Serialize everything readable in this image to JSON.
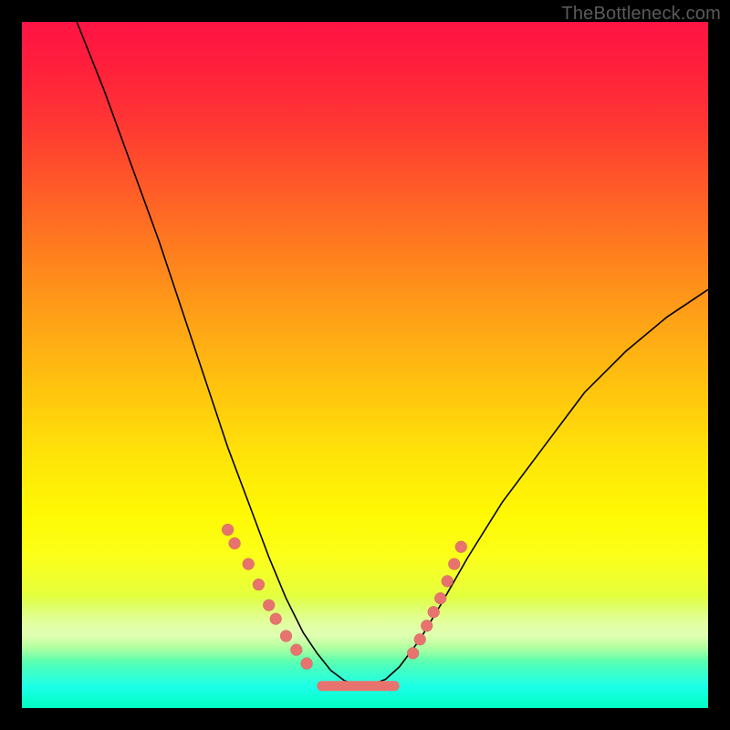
{
  "watermark": "TheBottleneck.com",
  "colors": {
    "dot": "#e8736e",
    "curve": "#000000",
    "frame": "#000000"
  },
  "chart_data": {
    "type": "line",
    "title": "",
    "xlabel": "",
    "ylabel": "",
    "xlim": [
      0,
      100
    ],
    "ylim": [
      0,
      100
    ],
    "grid": false,
    "legend": false,
    "series": [
      {
        "name": "bottleneck-curve",
        "x": [
          8,
          12,
          16,
          20,
          24,
          28,
          30,
          33,
          36,
          38.5,
          41,
          43,
          45,
          47,
          49,
          51,
          53,
          55,
          58,
          61,
          65,
          70,
          76,
          82,
          88,
          94,
          100
        ],
        "y": [
          100,
          90,
          79,
          68,
          56,
          44,
          38,
          30,
          22,
          16,
          11,
          8,
          5.5,
          4,
          3.3,
          3.4,
          4.2,
          6,
          10,
          15,
          22,
          30,
          38,
          46,
          52,
          57,
          61
        ]
      }
    ],
    "markers": {
      "left_cluster": [
        {
          "x": 30,
          "y": 26
        },
        {
          "x": 31,
          "y": 24
        },
        {
          "x": 33,
          "y": 21
        },
        {
          "x": 34.5,
          "y": 18
        },
        {
          "x": 36,
          "y": 15
        },
        {
          "x": 37,
          "y": 13
        },
        {
          "x": 38.5,
          "y": 10.5
        },
        {
          "x": 40,
          "y": 8.5
        },
        {
          "x": 41.5,
          "y": 6.5
        }
      ],
      "right_cluster": [
        {
          "x": 57,
          "y": 8
        },
        {
          "x": 58,
          "y": 10
        },
        {
          "x": 59,
          "y": 12
        },
        {
          "x": 60,
          "y": 14
        },
        {
          "x": 61,
          "y": 16
        },
        {
          "x": 62,
          "y": 18.5
        },
        {
          "x": 63,
          "y": 21
        },
        {
          "x": 64,
          "y": 23.5
        }
      ],
      "bottom_bar": {
        "x0": 43,
        "x1": 55,
        "y": 3.3
      }
    }
  }
}
